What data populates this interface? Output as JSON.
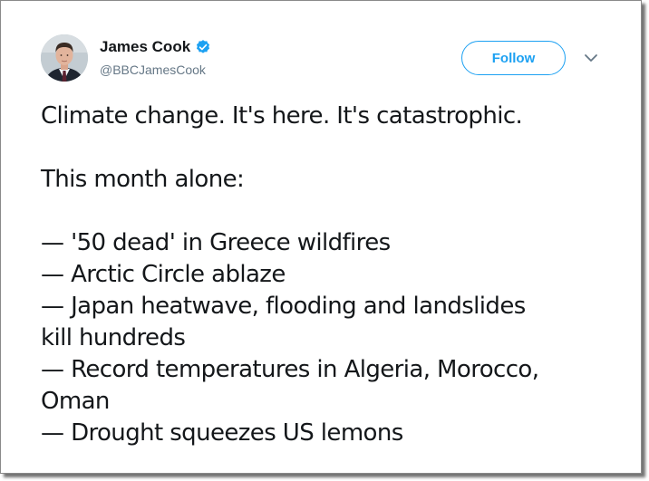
{
  "author": {
    "name": "James Cook",
    "handle": "@BBCJamesCook",
    "verified_color": "#1da1f2"
  },
  "actions": {
    "follow_label": "Follow"
  },
  "tweet": {
    "headline": "Climate change. It's here. It's catastrophic.",
    "intro": "This month alone:",
    "items": [
      "— '50 dead' in Greece wildfires",
      "— Arctic Circle ablaze",
      "— Japan heatwave, flooding and landslides",
      "kill hundreds",
      "— Record temperatures in Algeria, Morocco,",
      "Oman",
      "— Drought squeezes US lemons"
    ]
  },
  "colors": {
    "accent": "#1da1f2",
    "text": "#14171a",
    "muted": "#657786"
  }
}
